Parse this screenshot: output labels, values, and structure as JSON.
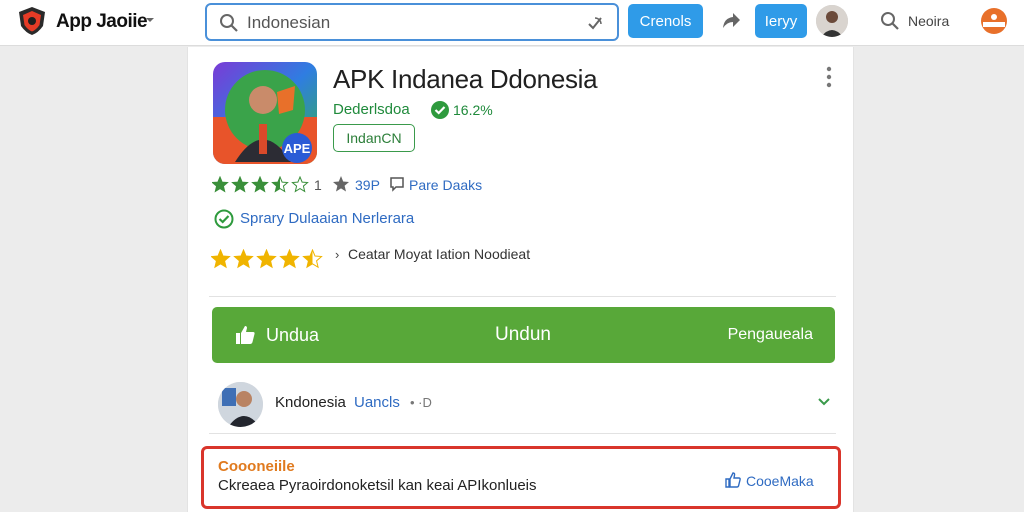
{
  "header": {
    "brand": "App Jaoiie",
    "search_value": "Indonesian",
    "search_button": "Crenols",
    "login_button": "Ieryy",
    "nav_text": "Neoira"
  },
  "app": {
    "title": "APK Indanea Ddonesia",
    "developer": "Dederlsdoa",
    "verified_percent": "16.2%",
    "tag": "IndanCN",
    "icon_badge": "APE",
    "rating_value": "1",
    "downloads": "39P",
    "reviews": "Pare Daaks",
    "safe_text": "Sprary Dulaaian Nerlerara",
    "category_text": "Ceatar Moyat Iation Noodieat",
    "rating_stars": 3.5,
    "rating_stars_2": 4.5
  },
  "download": {
    "left_label": "Undua",
    "center_label": "Undun",
    "right_label": "Pengaueala"
  },
  "author": {
    "name": "Kndonesia",
    "link": "Uancls",
    "extra": "• ·D"
  },
  "notice": {
    "title": "Coooneiile",
    "text": "Ckreaea Pyraoirdonoketsil kan keai APIkonlueis",
    "action": "CooeMaka"
  },
  "colors": {
    "accent_blue": "#2f9be8",
    "download_green": "#58a839",
    "notice_border": "#d9352b",
    "star_green": "#3a8f3a",
    "star_gold": "#f0b400"
  }
}
